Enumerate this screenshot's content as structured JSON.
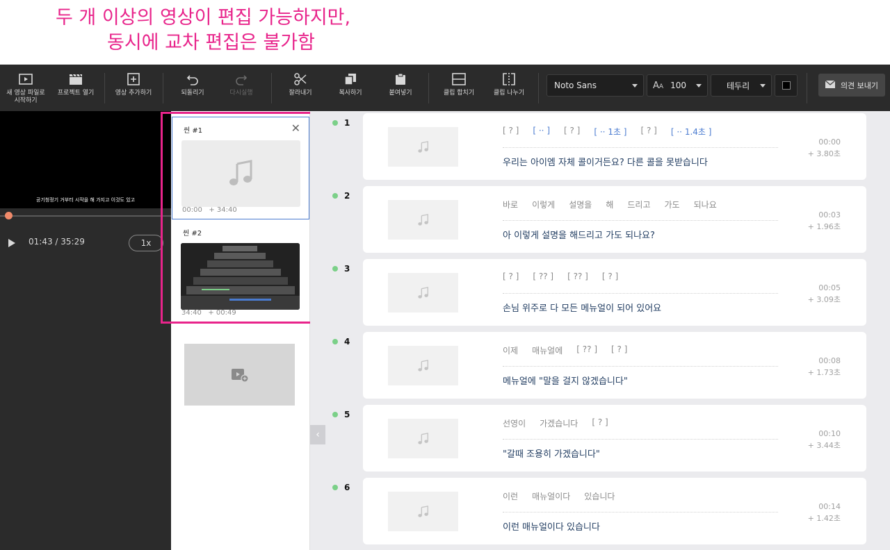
{
  "annotation": {
    "line1": "두 개 이상의 영상이 편집 가능하지만,",
    "line2": "동시에 교차 편집은 불가함"
  },
  "toolbar": {
    "new_file": "새 영상 파일로\n시작하기",
    "open_project": "프로젝트 열기",
    "add_video": "영상 추가하기",
    "undo": "되돌리기",
    "redo": "다시실행",
    "cut": "잘라내기",
    "copy": "복사하기",
    "paste": "붙여넣기",
    "merge_clip": "클립 합치기",
    "split_clip": "클립 나누기",
    "font": "Noto Sans",
    "font_size": "100",
    "border": "테두리",
    "feedback": "의견 보내기"
  },
  "player": {
    "subtitle": "공기청정기 거부터 시작을 해 가지고 이것도 있고",
    "time": "01:43 / 35:29",
    "speed": "1x",
    "progress": 0.049
  },
  "scenes": [
    {
      "title": "씬 #1",
      "start": "00:00",
      "duration": "+ 34:40",
      "selected": true
    },
    {
      "title": "씬 #2",
      "start": "34:40",
      "duration": "+ 00:49",
      "selected": false
    }
  ],
  "clips": [
    {
      "num": "1",
      "words": [
        {
          "t": "[ ? ]",
          "blue": false
        },
        {
          "t": "[ ·· ]",
          "blue": true
        },
        {
          "t": "[ ? ]",
          "blue": false
        },
        {
          "t": "[ ·· 1초 ]",
          "blue": true
        },
        {
          "t": "[ ? ]",
          "blue": false
        },
        {
          "t": "[ ·· 1.4초 ]",
          "blue": true
        }
      ],
      "sentence": "우리는 아이엠 자체 콜이거든요? 다른 콜을 못받습니다",
      "time": "00:00",
      "dur": "+ 3.80초"
    },
    {
      "num": "2",
      "words": [
        {
          "t": "바로",
          "blue": false
        },
        {
          "t": "이렇게",
          "blue": false
        },
        {
          "t": "설명을",
          "blue": false
        },
        {
          "t": "해",
          "blue": false
        },
        {
          "t": "드리고",
          "blue": false
        },
        {
          "t": "가도",
          "blue": false
        },
        {
          "t": "되나요",
          "blue": false
        }
      ],
      "sentence": "아 이렇게 설명을 해드리고 가도 되나요?",
      "time": "00:03",
      "dur": "+ 1.96초"
    },
    {
      "num": "3",
      "words": [
        {
          "t": "[ ? ]",
          "blue": false
        },
        {
          "t": "[ ?? ]",
          "blue": false
        },
        {
          "t": "[ ?? ]",
          "blue": false
        },
        {
          "t": "[ ? ]",
          "blue": false
        }
      ],
      "sentence": "손님 위주로 다 모든 메뉴얼이 되어 있어요",
      "time": "00:05",
      "dur": "+ 3.09초"
    },
    {
      "num": "4",
      "words": [
        {
          "t": "이제",
          "blue": false
        },
        {
          "t": "매뉴얼에",
          "blue": false
        },
        {
          "t": "[ ?? ]",
          "blue": false
        },
        {
          "t": "[ ? ]",
          "blue": false
        }
      ],
      "sentence": "메뉴얼에 \"말을 걸지 않겠습니다\"",
      "time": "00:08",
      "dur": "+ 1.73초"
    },
    {
      "num": "5",
      "words": [
        {
          "t": "선영이",
          "blue": false
        },
        {
          "t": "가겠습니다",
          "blue": false
        },
        {
          "t": "[ ? ]",
          "blue": false
        }
      ],
      "sentence": "\"갈때 조용히 가겠습니다\"",
      "time": "00:10",
      "dur": "+ 3.44초"
    },
    {
      "num": "6",
      "words": [
        {
          "t": "이런",
          "blue": false
        },
        {
          "t": "매뉴얼이다",
          "blue": false
        },
        {
          "t": "있습니다",
          "blue": false
        }
      ],
      "sentence": "이런 매뉴얼이다 있습니다",
      "time": "00:14",
      "dur": "+ 1.42초"
    }
  ]
}
